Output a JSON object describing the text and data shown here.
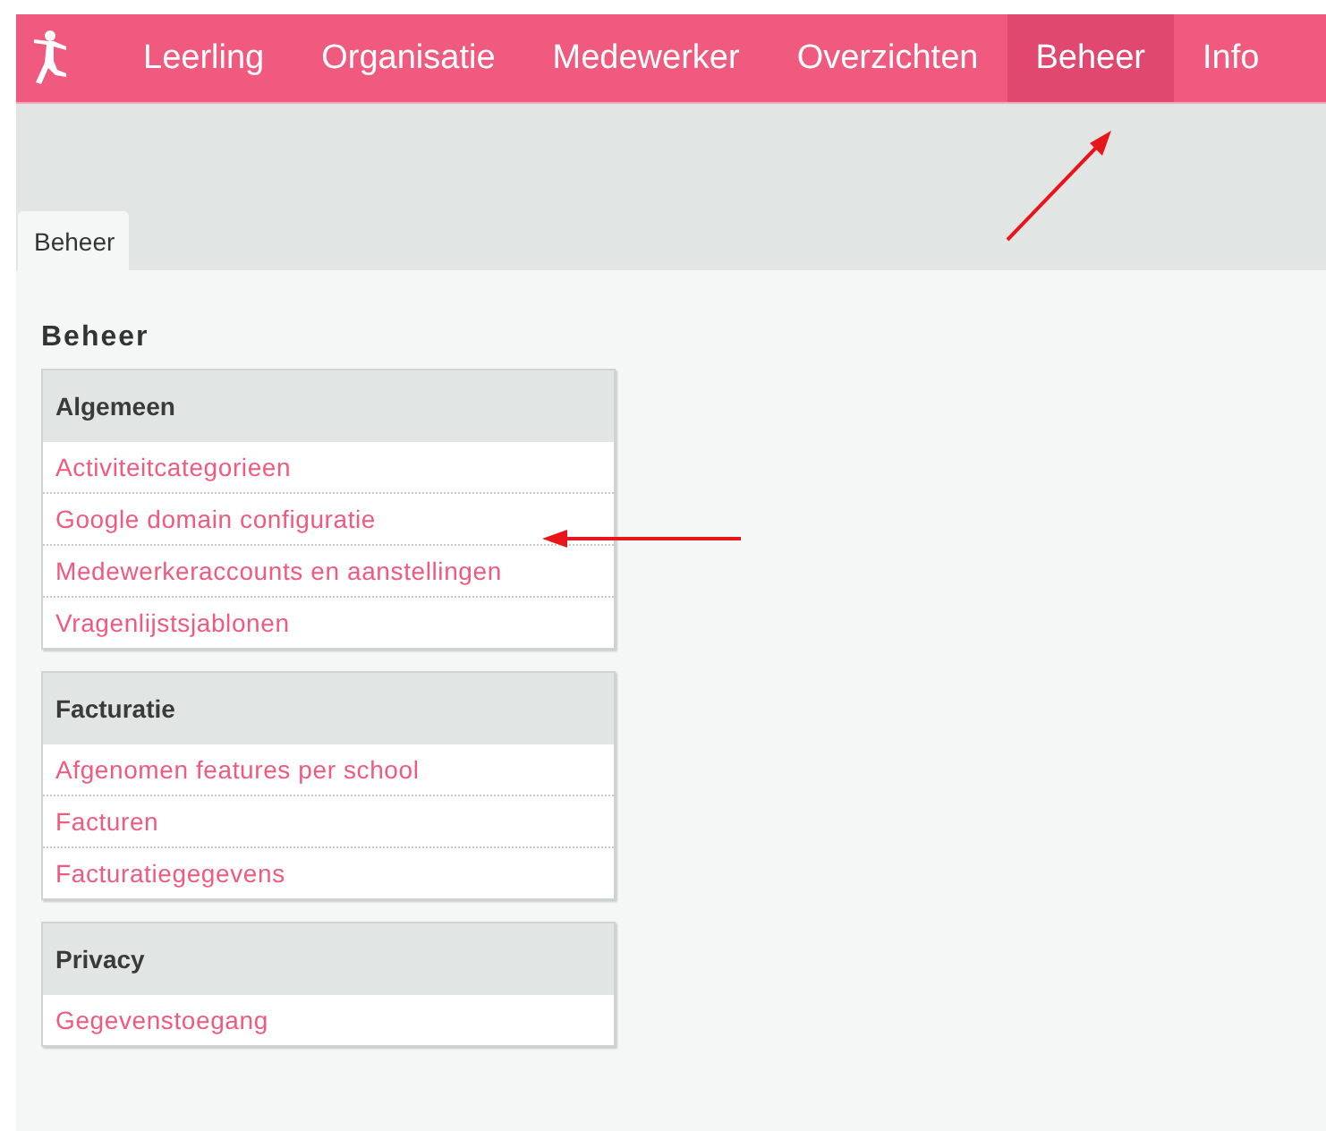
{
  "nav": {
    "items": [
      {
        "label": "Leerling",
        "selected": false
      },
      {
        "label": "Organisatie",
        "selected": false
      },
      {
        "label": "Medewerker",
        "selected": false
      },
      {
        "label": "Overzichten",
        "selected": false
      },
      {
        "label": "Beheer",
        "selected": true
      },
      {
        "label": "Info",
        "selected": false
      }
    ]
  },
  "tabs": [
    {
      "label": "Beheer",
      "selected": true
    }
  ],
  "heading": "Beheer",
  "sections": [
    {
      "title": "Algemeen",
      "links": [
        "Activiteitcategorieen",
        "Google domain configuratie",
        "Medewerkeraccounts en aanstellingen",
        "Vragenlijstsjablonen"
      ]
    },
    {
      "title": "Facturatie",
      "links": [
        "Afgenomen features per school",
        "Facturen",
        "Facturatiegegevens"
      ]
    },
    {
      "title": "Privacy",
      "links": [
        "Gegevenstoegang"
      ]
    }
  ]
}
